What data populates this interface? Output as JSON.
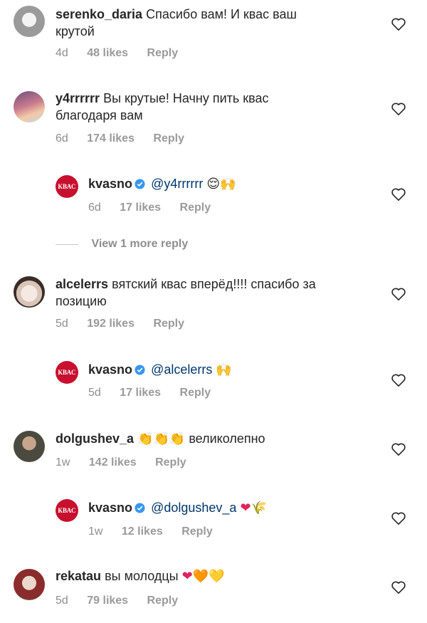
{
  "labels": {
    "view_more": "View 1 more reply"
  },
  "icons": {
    "heart": "heart-outline-icon",
    "verified": "verified-badge-icon"
  },
  "colors": {
    "mention": "#00376b",
    "meta": "#8e8e8e",
    "brand": "#c8102e",
    "verified": "#3897f0"
  },
  "comments": [
    {
      "user": "serenko_daria",
      "text_line1": "Спасибо вам! И квас ваш",
      "text_line2": "крутой",
      "age": "4d",
      "likes": "48 likes",
      "reply": "Reply"
    },
    {
      "user": "y4rrrrrr",
      "text_line1": "Вы крутые! Начну пить квас",
      "text_line2": "благодаря вам",
      "age": "6d",
      "likes": "174 likes",
      "reply": "Reply"
    },
    {
      "user": "kvasno",
      "mention": "@y4rrrrrr",
      "emoji": "😌🙌",
      "age": "6d",
      "likes": "17 likes",
      "reply": "Reply",
      "logo": "КВАС"
    },
    {
      "user": "alcelerrs",
      "text_line1": "вятский квас вперёд!!!! спасибо за",
      "text_line2": "позицию",
      "age": "5d",
      "likes": "192 likes",
      "reply": "Reply"
    },
    {
      "user": "kvasno",
      "mention": "@alcelerrs",
      "emoji": "🙌",
      "age": "5d",
      "likes": "17 likes",
      "reply": "Reply",
      "logo": "КВАС"
    },
    {
      "user": "dolgushev_a",
      "emoji": "👏👏👏",
      "text": "великолепно",
      "age": "1w",
      "likes": "142 likes",
      "reply": "Reply"
    },
    {
      "user": "kvasno",
      "mention": "@dolgushev_a",
      "emoji": "❤🌾",
      "age": "1w",
      "likes": "12 likes",
      "reply": "Reply",
      "logo": "КВАС"
    },
    {
      "user": "rekatau",
      "text": "вы молодцы",
      "emoji": "❤🧡💛",
      "age": "5d",
      "likes": "79 likes",
      "reply": "Reply"
    }
  ]
}
